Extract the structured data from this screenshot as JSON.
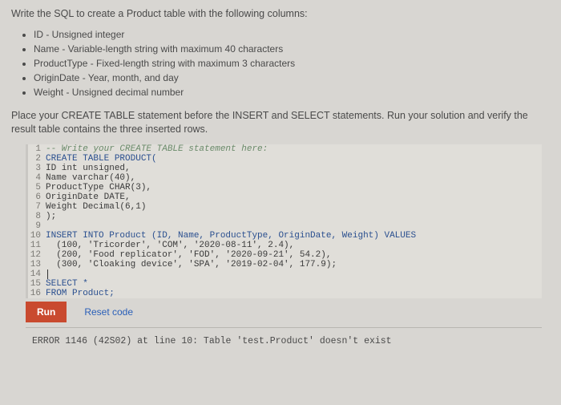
{
  "intro": "Write the SQL to create a Product table with the following columns:",
  "specs": [
    "ID - Unsigned integer",
    "Name - Variable-length string with maximum 40 characters",
    "ProductType - Fixed-length string with maximum 3 characters",
    "OriginDate - Year, month, and day",
    "Weight - Unsigned decimal number"
  ],
  "instr": "Place your CREATE TABLE statement before the INSERT and SELECT statements. Run your solution and verify the result table contains the three inserted rows.",
  "code": {
    "l1": "-- Write your CREATE TABLE statement here:",
    "l2": "CREATE TABLE PRODUCT(",
    "l3": "ID int unsigned,",
    "l4": "Name varchar(40),",
    "l5": "ProductType CHAR(3),",
    "l6": "OriginDate DATE,",
    "l7": "Weight Decimal(6,1)",
    "l8": ");",
    "l9": "",
    "l10": "INSERT INTO Product (ID, Name, ProductType, OriginDate, Weight) VALUES",
    "l11": "  (100, 'Tricorder', 'COM', '2020-08-11', 2.4),",
    "l12": "  (200, 'Food replicator', 'FOD', '2020-09-21', 54.2),",
    "l13": "  (300, 'Cloaking device', 'SPA', '2019-02-04', 177.9);",
    "l14": "",
    "l15": "SELECT *",
    "l16": "FROM Product;"
  },
  "buttons": {
    "run": "Run",
    "reset": "Reset code"
  },
  "error": "ERROR 1146 (42S02) at line 10: Table 'test.Product' doesn't exist"
}
